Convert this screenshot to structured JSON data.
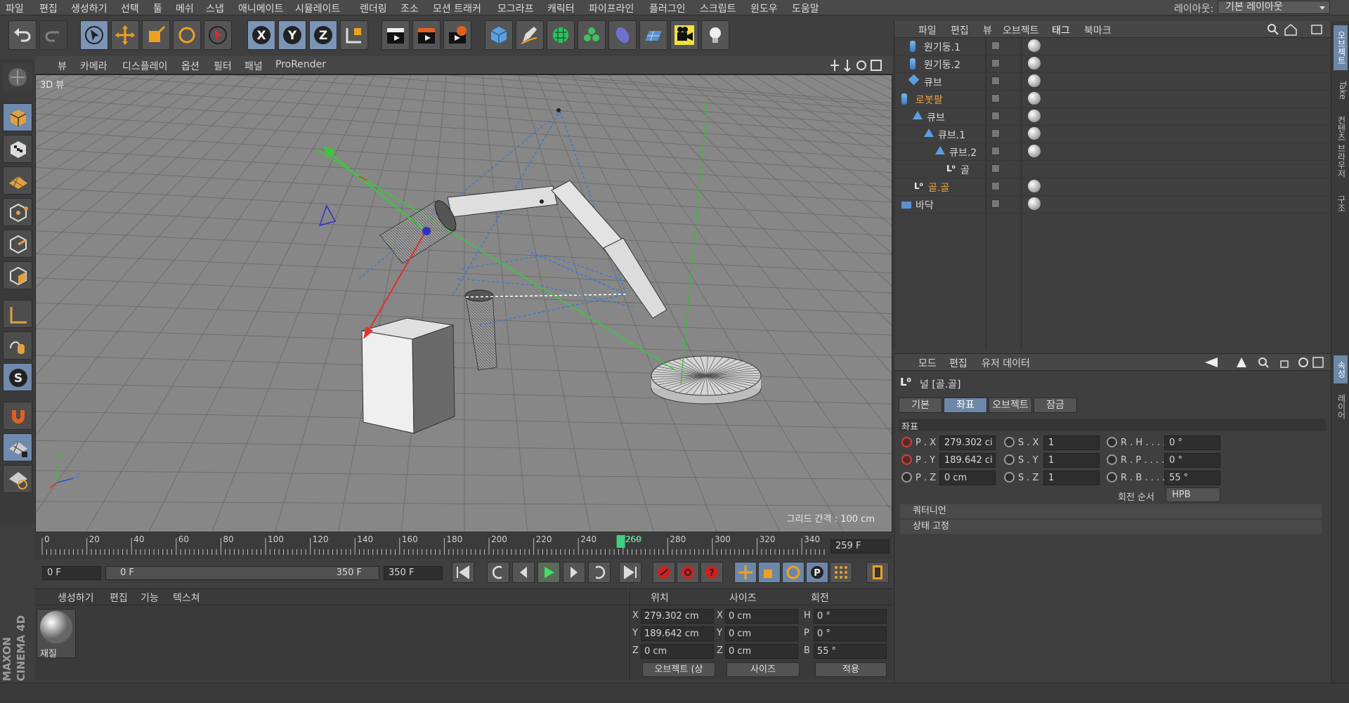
{
  "menubar": {
    "items": [
      "파일",
      "편집",
      "생성하기",
      "선택",
      "툴",
      "메쉬",
      "스냅",
      "애니메이트",
      "시뮬레이트",
      "렌더링",
      "조소",
      "모션 트래커",
      "모그라프",
      "캐릭터",
      "파이프라인",
      "플러그인",
      "스크립트",
      "윈도우",
      "도움말"
    ],
    "layout_label": "레이아웃:",
    "layout_value": "기본 레이아웃"
  },
  "viewport": {
    "menu": [
      "뷰",
      "카메라",
      "디스플레이",
      "옵션",
      "필터",
      "패널",
      "ProRender"
    ],
    "title": "3D 뷰",
    "grid_spacing": "그리드 간격 : 100 cm",
    "axis_y": "Y",
    "axis_z": "Z"
  },
  "timeline": {
    "ticks": [
      "0",
      "20",
      "40",
      "60",
      "80",
      "100",
      "120",
      "140",
      "160",
      "180",
      "200",
      "220",
      "240",
      "260",
      "280",
      "300",
      "320",
      "340"
    ],
    "current_frame": "259",
    "current_frame_field": "259 F",
    "start_field": "0 F",
    "range_start": "0 F",
    "range_end": "350 F",
    "end_field": "350 F"
  },
  "material_panel": {
    "menu": [
      "생성하기",
      "편집",
      "기능",
      "텍스쳐"
    ],
    "material_name": "재질"
  },
  "coord_panel": {
    "headers": [
      "위치",
      "사이즈",
      "회전"
    ],
    "pos": [
      {
        "axis": "X",
        "value": "279.302 cm"
      },
      {
        "axis": "Y",
        "value": "189.642 cm"
      },
      {
        "axis": "Z",
        "value": "0 cm"
      }
    ],
    "size": [
      {
        "axis": "X",
        "value": "0 cm"
      },
      {
        "axis": "Y",
        "value": "0 cm"
      },
      {
        "axis": "Z",
        "value": "0 cm"
      }
    ],
    "rot": [
      {
        "axis": "H",
        "value": "0 °"
      },
      {
        "axis": "P",
        "value": "0 °"
      },
      {
        "axis": "B",
        "value": "55 °"
      }
    ],
    "mode_select": "오브젝트 (상",
    "size_select": "사이즈",
    "apply": "적용"
  },
  "object_panel": {
    "menu": [
      "파일",
      "편집",
      "뷰",
      "오브젝트",
      "태그",
      "북마크"
    ],
    "objects": [
      {
        "name": "원기둥.1",
        "selected": false
      },
      {
        "name": "원기둥.2",
        "selected": false
      },
      {
        "name": "큐브",
        "selected": false
      },
      {
        "name": "로봇팔",
        "selected": true
      },
      {
        "name": "큐브",
        "selected": false
      },
      {
        "name": "큐브.1",
        "selected": false
      },
      {
        "name": "큐브.2",
        "selected": false
      },
      {
        "name": "골",
        "selected": false
      },
      {
        "name": "골.골",
        "selected": true
      },
      {
        "name": "바닥",
        "selected": false
      }
    ]
  },
  "attr_panel": {
    "menu": [
      "모드",
      "편집",
      "유저 데이터"
    ],
    "title": "널 [골.골]",
    "tabs": [
      "기본",
      "좌표",
      "오브젝트",
      "잠금"
    ],
    "active_tab": "좌표",
    "section": "좌표",
    "px_label": "P . X",
    "py_label": "P . Y",
    "pz_label": "P . Z",
    "sx_label": "S . X",
    "sy_label": "S . Y",
    "sz_label": "S . Z",
    "rh_label": "R . H . . . .",
    "rp_label": "R . P . . . .",
    "rb_label": "R . B . . . .",
    "px": "279.302 ci",
    "py": "189.642 ci",
    "pz": "0 cm",
    "sx": "1",
    "sy": "1",
    "sz": "1",
    "rh": "0 °",
    "rp": "0 °",
    "rb": "55 °",
    "rot_order_label": "회전 순서",
    "rot_order": "HPB",
    "collapsed": [
      "쿼터니언",
      "상태 고정"
    ]
  },
  "side_tabs": [
    "오브젝트",
    "Take",
    "컨텐츠 브라우저",
    "구조",
    "속성",
    "레이어"
  ],
  "branding": "MAXON CINEMA 4D",
  "colors": {
    "accent": "#6c87a8",
    "selected_text": "#f0a040",
    "viewport_bg": "#878787"
  }
}
